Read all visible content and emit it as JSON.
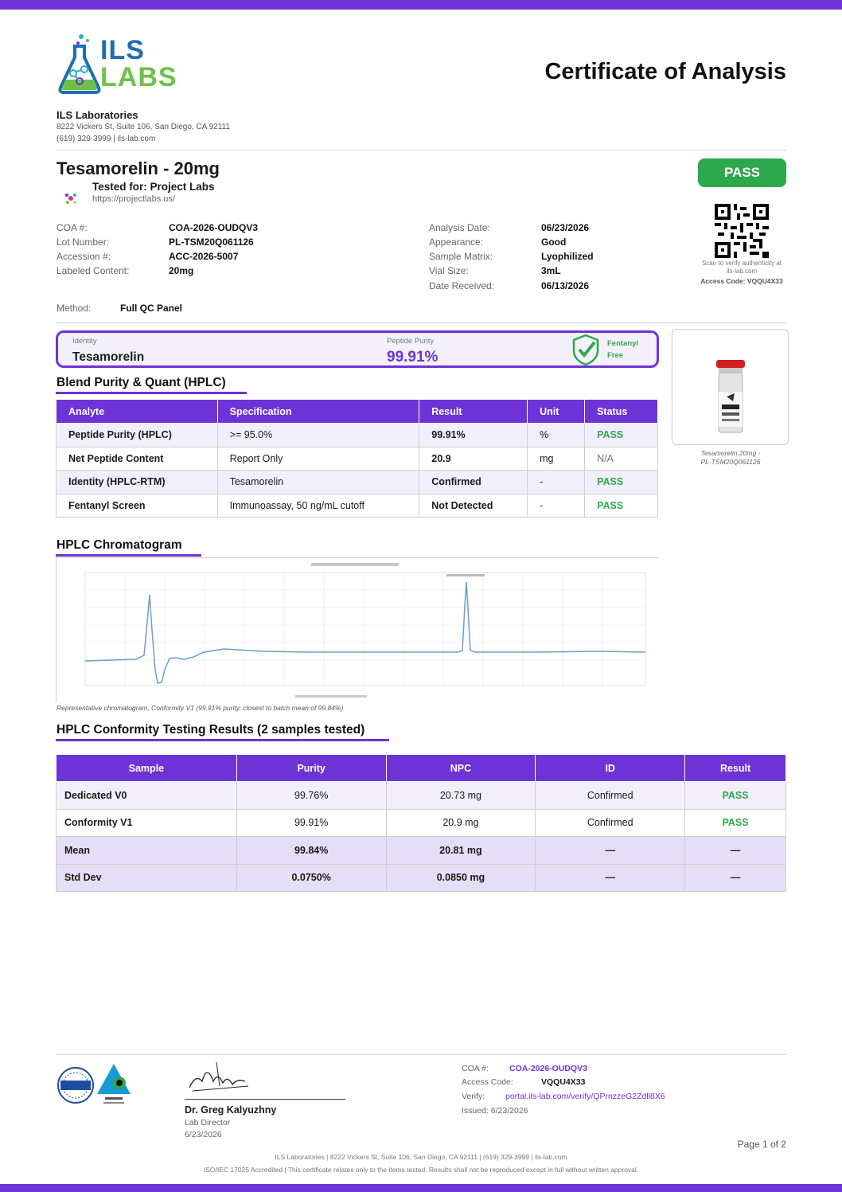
{
  "colors": {
    "accent": "#6d33d6",
    "pass": "#2ea84d"
  },
  "header": {
    "logo_line1": "ILS",
    "logo_line2": "LABS",
    "title": "Certificate of Analysis",
    "lab_name": "ILS Laboratories",
    "lab_address": "8222 Vickers St, Suite 106, San Diego, CA 92111",
    "lab_contact": "(619) 329-3999  |  ils-lab.com"
  },
  "product": {
    "name": "Tesamorelin - 20mg",
    "tested_for": "Tested for: Project Labs",
    "url": "https://projectlabs.us/",
    "overall_status": "PASS"
  },
  "details_left": [
    {
      "label": "COA #:",
      "value": "COA-2026-OUDQV3"
    },
    {
      "label": "Lot Number:",
      "value": "PL-TSM20Q061126"
    },
    {
      "label": "Accession #:",
      "value": "ACC-2026-5007"
    },
    {
      "label": "Labeled Content:",
      "value": "20mg"
    }
  ],
  "details_right": [
    {
      "label": "Analysis Date:",
      "value": "06/23/2026"
    },
    {
      "label": "Appearance:",
      "value": "Good"
    },
    {
      "label": "Sample Matrix:",
      "value": "Lyophilized"
    },
    {
      "label": "Vial Size:",
      "value": "3mL"
    },
    {
      "label": "Date Received:",
      "value": "06/13/2026"
    }
  ],
  "qr": {
    "scan_text": "Scan to verify authenticity at ils-lab.com",
    "access_code": "Access Code: VQQU4X33"
  },
  "method": {
    "label": "Method:",
    "value": "Full QC Panel"
  },
  "summary": {
    "identity_label": "Identity",
    "identity_value": "Tesamorelin",
    "purity_label": "Peptide Purity",
    "purity_value": "99.91%",
    "fentanyl_line1": "Fentanyl",
    "fentanyl_line2": "Free"
  },
  "vial": {
    "caption_line1": "Tesamorelin 20mg -",
    "caption_line2": "PL-TSM20Q061126"
  },
  "blend": {
    "heading": "Blend Purity & Quant (HPLC)",
    "headers": [
      "Analyte",
      "Specification",
      "Result",
      "Unit",
      "Status"
    ],
    "rows": [
      [
        "Peptide Purity (HPLC)",
        ">= 95.0%",
        "99.91%",
        "%",
        "PASS"
      ],
      [
        "Net Peptide Content",
        "Report Only",
        "20.9",
        "mg",
        "N/A"
      ],
      [
        "Identity (HPLC-RTM)",
        "Tesamorelin",
        "Confirmed",
        "-",
        "PASS"
      ],
      [
        "Fentanyl Screen",
        "Immunoassay, 50 ng/mL cutoff",
        "Not Detected",
        "-",
        "PASS"
      ]
    ]
  },
  "chromatogram": {
    "heading": "HPLC Chromatogram",
    "caption": "Representative chromatogram, Conformity V1 (99.91% purity, closest to batch mean of 99.84%)"
  },
  "conformity": {
    "heading": "HPLC Conformity Testing Results (2 samples tested)",
    "headers": [
      "Sample",
      "Purity",
      "NPC",
      "ID",
      "Result"
    ],
    "rows": [
      [
        "Dedicated V0",
        "99.76%",
        "20.73 mg",
        "Confirmed",
        "PASS"
      ],
      [
        "Conformity V1",
        "99.91%",
        "20.9 mg",
        "Confirmed",
        "PASS"
      ],
      [
        "Mean",
        "99.84%",
        "20.81 mg",
        "—",
        "—"
      ],
      [
        "Std Dev",
        "0.0750%",
        "0.0850 mg",
        "—",
        "—"
      ]
    ]
  },
  "signature": {
    "name": "Dr. Greg Kalyuzhny",
    "title": "Lab Director",
    "date": "6/23/2026"
  },
  "footer_info": [
    {
      "label": "COA #:",
      "value": "COA-2026-OUDQV3"
    },
    {
      "label": "Access Code:",
      "value": "VQQU4X33"
    },
    {
      "label": "Verify:",
      "value": "portal.ils-lab.com/verify/QPrnzzeG2Zdll8X6"
    }
  ],
  "issued": "Issued: 6/23/2026",
  "page": "Page 1 of 2",
  "footer_line1": "ILS Laboratories  |  8222 Vickers St, Suite 106, San Diego, CA 92111  |  (619) 329-3999  |  ils-lab.com",
  "footer_line2": "ISO/IEC 17025 Accredited  |  This certificate relates only to the items tested. Results shall not be reproduced except in full without written approval."
}
